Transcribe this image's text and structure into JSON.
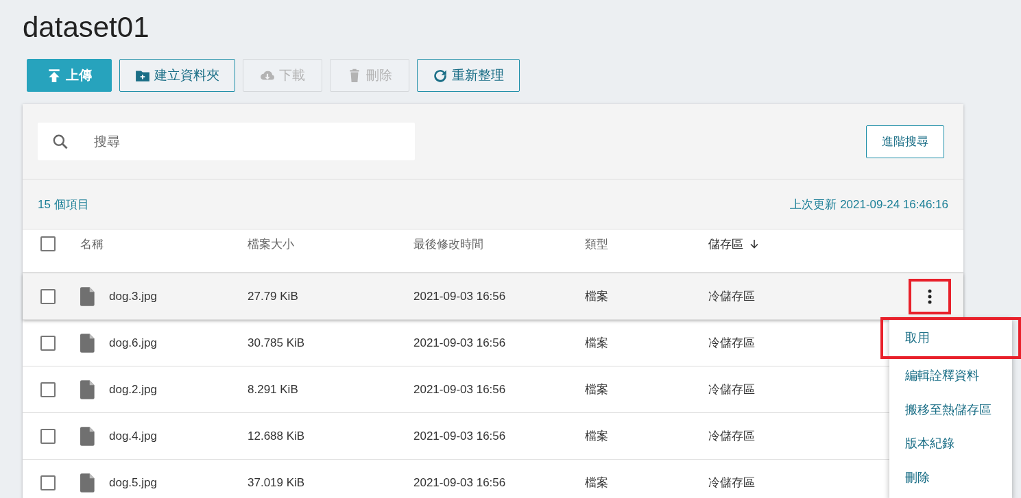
{
  "title": "dataset01",
  "toolbar": [
    {
      "kind": "upload",
      "label": "上傳",
      "primary": true,
      "disabled": false
    },
    {
      "kind": "new-folder",
      "label": "建立資料夾",
      "primary": false,
      "disabled": false
    },
    {
      "kind": "download",
      "label": "下載",
      "primary": false,
      "disabled": true
    },
    {
      "kind": "delete",
      "label": "刪除",
      "primary": false,
      "disabled": true
    },
    {
      "kind": "refresh",
      "label": "重新整理",
      "primary": false,
      "disabled": false
    }
  ],
  "search": {
    "placeholder": "搜尋",
    "advanced_button": "進階搜尋"
  },
  "summary": {
    "item_count": "15 個項目",
    "last_updated": "上次更新 2021-09-24 16:46:16"
  },
  "table": {
    "select_all_checked": false,
    "columns": [
      {
        "label": "名稱",
        "sorted": false
      },
      {
        "label": "檔案大小",
        "sorted": false
      },
      {
        "label": "最後修改時間",
        "sorted": false
      },
      {
        "label": "類型",
        "sorted": false
      },
      {
        "label": "儲存區",
        "sorted": true
      }
    ],
    "rows": [
      {
        "name": "dog.3.jpg",
        "size": "27.79 KiB",
        "modified": "2021-09-03 16:56",
        "type": "檔案",
        "storage": "冷儲存區",
        "checked": false,
        "hovered": true
      },
      {
        "name": "dog.6.jpg",
        "size": "30.785 KiB",
        "modified": "2021-09-03 16:56",
        "type": "檔案",
        "storage": "冷儲存區",
        "checked": false,
        "hovered": false
      },
      {
        "name": "dog.2.jpg",
        "size": "8.291 KiB",
        "modified": "2021-09-03 16:56",
        "type": "檔案",
        "storage": "冷儲存區",
        "checked": false,
        "hovered": false
      },
      {
        "name": "dog.4.jpg",
        "size": "12.688 KiB",
        "modified": "2021-09-03 16:56",
        "type": "檔案",
        "storage": "冷儲存區",
        "checked": false,
        "hovered": false
      },
      {
        "name": "dog.5.jpg",
        "size": "37.019 KiB",
        "modified": "2021-09-03 16:56",
        "type": "檔案",
        "storage": "冷儲存區",
        "checked": false,
        "hovered": false
      }
    ]
  },
  "row_menu": {
    "open": true,
    "items": [
      {
        "label": "取用",
        "highlighted": true
      },
      {
        "label": "編輯詮釋資料",
        "highlighted": false
      },
      {
        "label": "搬移至熱儲存區",
        "highlighted": false
      },
      {
        "label": "版本紀錄",
        "highlighted": false
      },
      {
        "label": "刪除",
        "highlighted": false
      }
    ]
  }
}
